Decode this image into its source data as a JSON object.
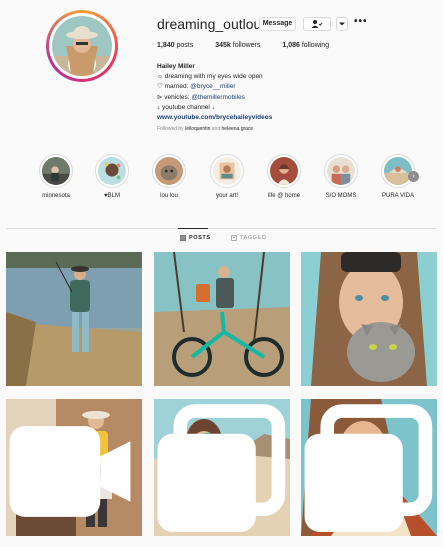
{
  "profile": {
    "username": "dreaming_outloud",
    "buttons": {
      "message": "Message",
      "follow_icon": "person-check-icon",
      "dropdown_icon": "chevron-down-icon",
      "more_icon": "more-dots-icon"
    },
    "stats": {
      "posts": "1,840",
      "posts_label": "posts",
      "followers": "345k",
      "followers_label": "followers",
      "following": "1,086",
      "following_label": "following"
    },
    "bio": {
      "name": "Hailey Miller",
      "line1": "☼ dreaming with my eyes wide open",
      "line2_prefix": "♡ married: ",
      "line2_mention": "@bryce__miller",
      "line3_prefix": "⊳ vehicles: ",
      "line3_mention": "@themillermobiles",
      "line4": "↓ youtube channel ↓",
      "link": "www.youtube.com/brycehaileyvideos"
    },
    "followed_by": {
      "prefix": "Followed by ",
      "user1": "leiloquentin",
      "and": " and ",
      "user2": "heleena.grace"
    }
  },
  "highlights": [
    {
      "label": "minnesota"
    },
    {
      "label": "♥BLM"
    },
    {
      "label": "lou lou"
    },
    {
      "label": "your art!"
    },
    {
      "label": "life @ home"
    },
    {
      "label": "S/O MOMS"
    },
    {
      "label": "PURA VIDA"
    }
  ],
  "highlights_next_icon": "chevron-right-icon",
  "tabs": {
    "posts": "POSTS",
    "tagged": "TAGGED"
  },
  "posts": [
    {
      "subject": "fishing by lake",
      "badge": ""
    },
    {
      "subject": "mountain bike",
      "badge": ""
    },
    {
      "subject": "with cat",
      "badge": ""
    },
    {
      "subject": "record player",
      "badge": "video-icon"
    },
    {
      "subject": "beach phone",
      "badge": "multi-photo-icon"
    },
    {
      "subject": "smiling portrait",
      "badge": "multi-photo-icon"
    }
  ],
  "colors": {
    "text": "#262626",
    "muted": "#8e8e8e",
    "link": "#1c3f6e",
    "border": "#dbdbdb",
    "bg": "#fafafa"
  }
}
